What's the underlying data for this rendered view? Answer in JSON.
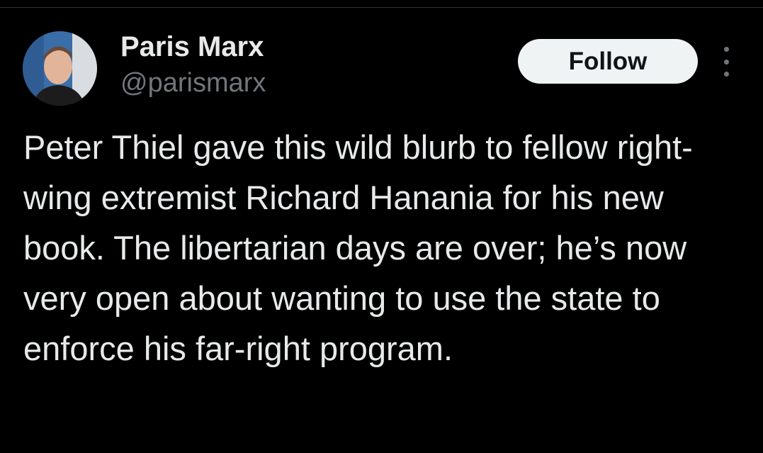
{
  "tweet": {
    "author": {
      "display_name": "Paris Marx",
      "handle": "@parismarx"
    },
    "follow_label": "Follow",
    "text": "Peter Thiel gave this wild blurb to fellow right-wing extremist Richard Hanania for his new book. The libertarian days are over; he’s now very open about wanting to use the state to enforce his far-right program."
  },
  "icons": {
    "more": "more-options-icon",
    "avatar": "avatar-photo"
  },
  "colors": {
    "background": "#000000",
    "text_primary": "#e7e9ea",
    "text_secondary": "#71767b",
    "follow_button_bg": "#eff3f4",
    "follow_button_text": "#0f1419"
  }
}
